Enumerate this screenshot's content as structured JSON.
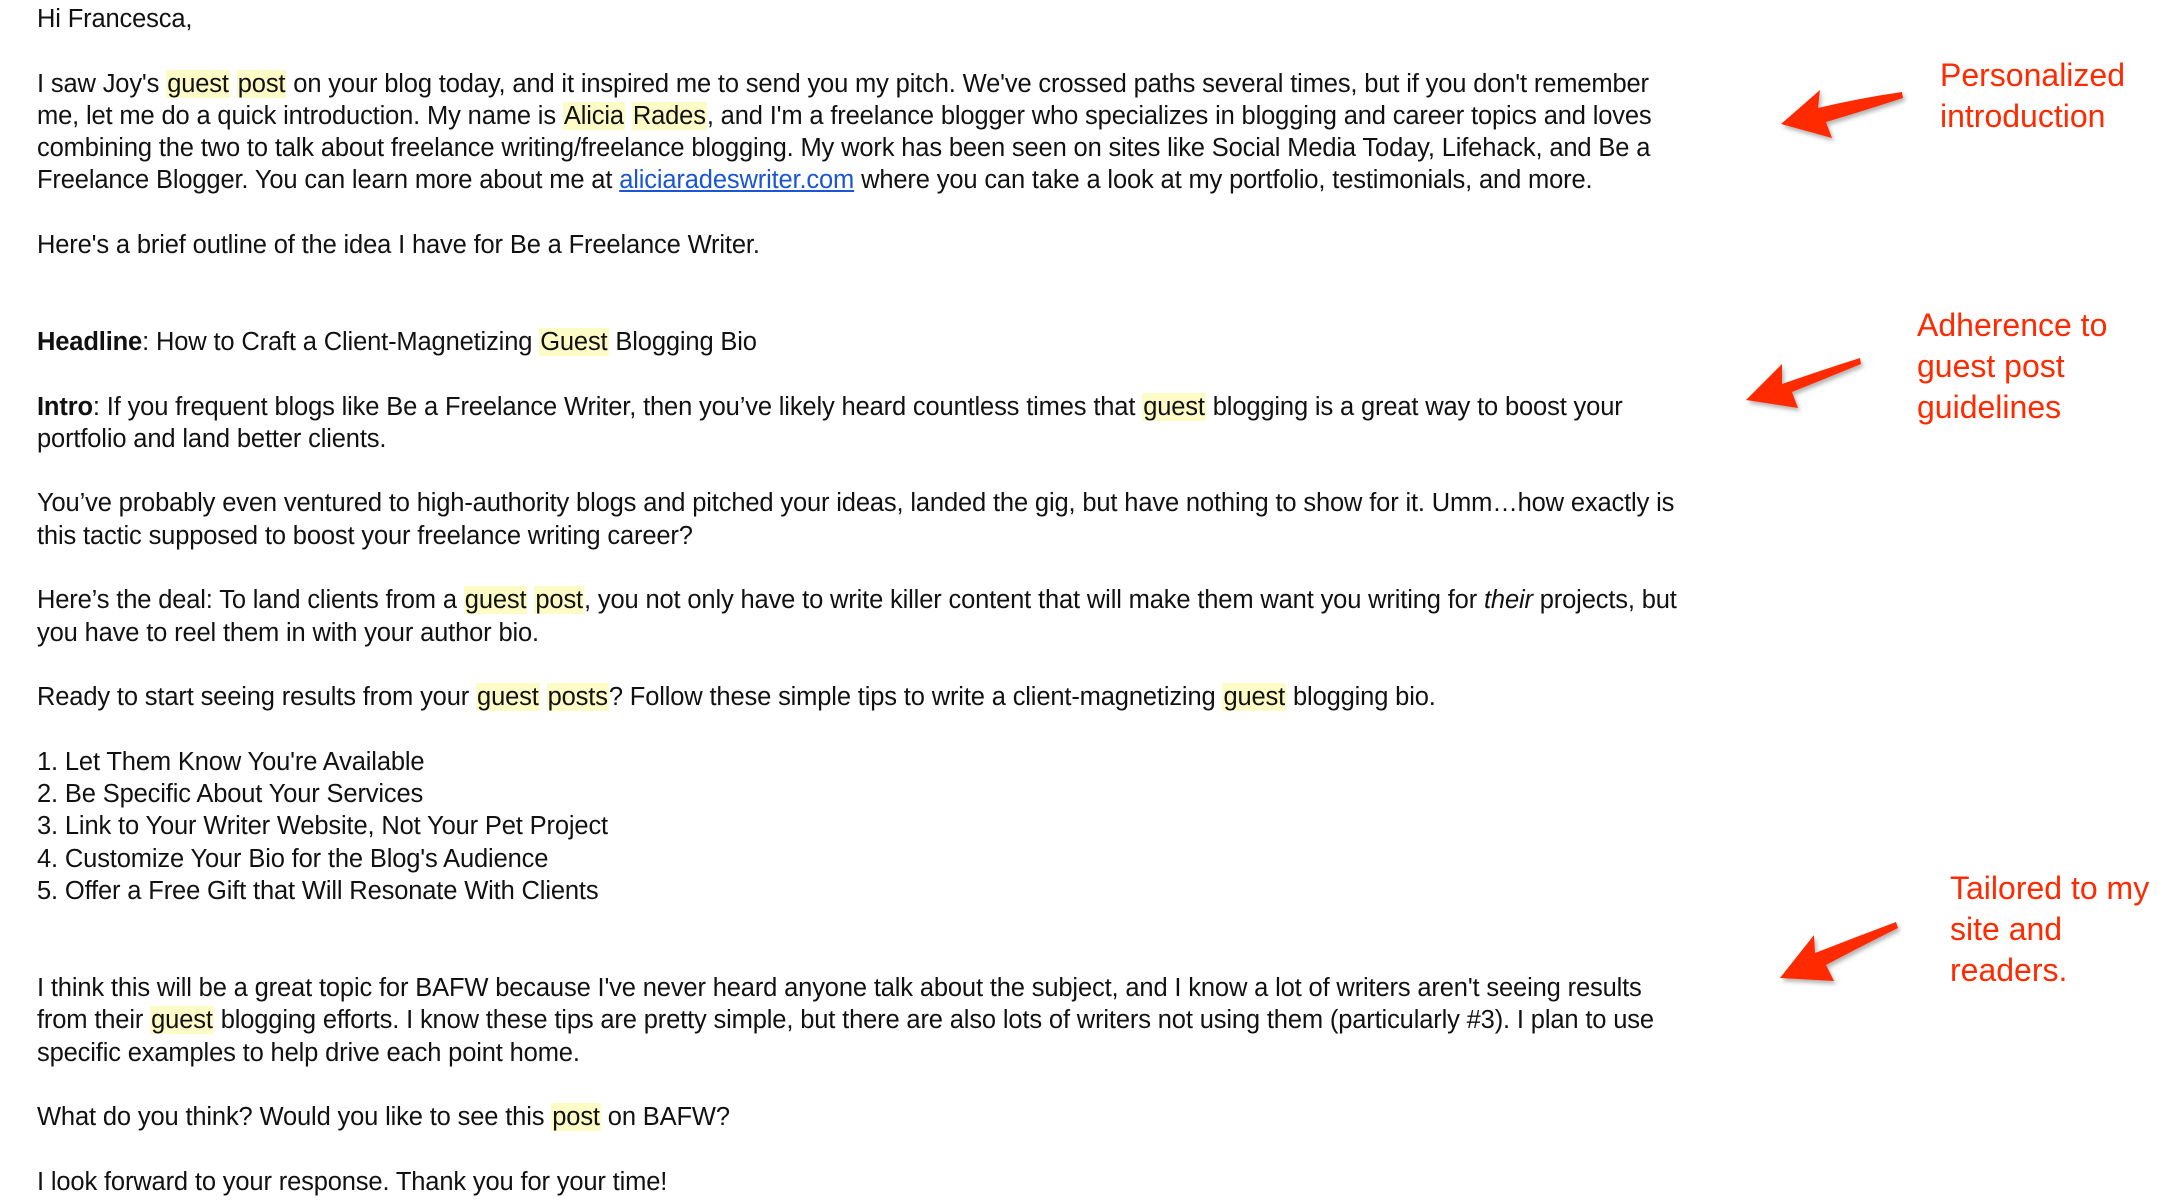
{
  "email": {
    "greeting": "Hi Francesca,",
    "intro_paragraph": {
      "l1_a": "I saw Joy's ",
      "l1_hl1": "guest",
      "l1_sp": " ",
      "l1_hl2": "post",
      "l1_b": " on your blog today, and it inspired me to send you my pitch. We've crossed paths several times, but if you don't remember",
      "l2_a": "me, let me do a quick introduction. My name is ",
      "l2_hl1": "Alicia",
      "l2_sp": " ",
      "l2_hl2": "Rades",
      "l2_b": ", and I'm a freelance blogger who specializes in blogging and career topics and loves",
      "l3": "combining the two to talk about freelance writing/freelance blogging. My work has been seen on sites like Social Media Today, Lifehack, and Be a",
      "l4_a": "Freelance Blogger. You can learn more about me at ",
      "l4_link": "aliciaradeswriter.com",
      "l4_b": " where you can take a look at my portfolio, testimonials, and more."
    },
    "outline_intro": "Here's a brief outline of the idea I have for Be a Freelance Writer.",
    "headline": {
      "label": "Headline",
      "a": ": How to Craft a Client-Magnetizing ",
      "hl": "Guest",
      "b": " Blogging Bio"
    },
    "intro": {
      "label": "Intro",
      "l1_a": ": If you frequent blogs like Be a Freelance Writer, then you’ve likely heard countless times that ",
      "l1_hl": "guest",
      "l1_b": " blogging is a great way to boost your",
      "l2": "portfolio and land better clients."
    },
    "para_probably": {
      "l1": "You’ve probably even ventured to high-authority blogs and pitched your ideas, landed the gig, but have nothing to show for it. Umm…how exactly is",
      "l2": "this tactic supposed to boost your freelance writing career?"
    },
    "para_deal": {
      "l1_a": "Here’s the deal: To land clients from a ",
      "l1_hl1": "guest",
      "l1_sp": " ",
      "l1_hl2": "post",
      "l1_b": ", you not only have to write killer content that will make them want you writing for ",
      "l1_em": "their",
      "l1_c": " projects, but",
      "l2": "you have to reel them in with your author bio."
    },
    "para_ready": {
      "a": "Ready to start seeing results from your ",
      "hl1": "guest",
      "sp": " ",
      "hl2": "posts",
      "b": "? Follow these simple tips to write a client-magnetizing ",
      "hl3": "guest",
      "c": " blogging bio."
    },
    "tips": [
      "1. Let Them Know You're Available",
      "2. Be Specific About Your Services",
      "3. Link to Your Writer Website, Not Your Pet Project",
      "4. Customize Your Bio for the Blog's Audience",
      "5. Offer a Free Gift that Will Resonate With Clients"
    ],
    "para_think": {
      "l1": "I think this will be a great topic for BAFW because I've never heard anyone talk about the subject, and I know a lot of writers aren't seeing results",
      "l2_a": "from their ",
      "l2_hl": "guest",
      "l2_b": " blogging efforts. I know these tips are pretty simple, but there are also lots of writers not using them (particularly #3). I plan to use",
      "l3": "specific examples to help drive each point home."
    },
    "para_question": {
      "a": "What do you think? Would you like to see this ",
      "hl": "post",
      "b": " on BAFW?"
    },
    "closing": "I look forward to your response. Thank you for your time!"
  },
  "annotations": [
    {
      "lines": [
        "Personalized",
        "introduction"
      ]
    },
    {
      "lines": [
        "Adherence to",
        "guest post",
        "guidelines"
      ]
    },
    {
      "lines": [
        "Tailored to my",
        "site and",
        "readers."
      ]
    }
  ],
  "colors": {
    "annotation": "#ff2a00",
    "highlight": "#fdfbc6",
    "link": "#1a55d6",
    "text": "#111111"
  }
}
